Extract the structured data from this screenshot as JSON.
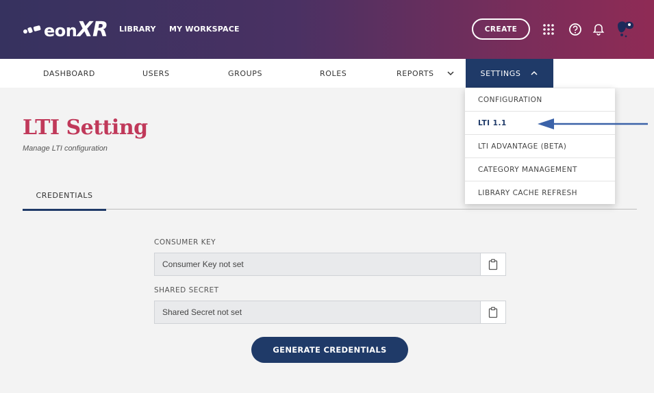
{
  "header": {
    "logo_text": "eon",
    "logo_xr": "XR",
    "links": [
      "LIBRARY",
      "MY WORKSPACE"
    ],
    "create_label": "CREATE"
  },
  "nav": {
    "items": [
      "DASHBOARD",
      "USERS",
      "GROUPS",
      "ROLES",
      "REPORTS"
    ],
    "active": "SETTINGS"
  },
  "settings_menu": {
    "items": [
      "CONFIGURATION",
      "LTI 1.1",
      "LTI ADVANTAGE (BETA)",
      "CATEGORY MANAGEMENT",
      "LIBRARY CACHE REFRESH"
    ],
    "active": "LTI 1.1"
  },
  "page": {
    "title": "LTI Setting",
    "subtitle": "Manage LTI configuration"
  },
  "tabs": [
    "CREDENTIALS"
  ],
  "form": {
    "consumer_key_label": "CONSUMER KEY",
    "consumer_key_value": "Consumer Key not set",
    "shared_secret_label": "SHARED SECRET",
    "shared_secret_value": "Shared Secret not set",
    "generate_label": "GENERATE CREDENTIALS"
  },
  "colors": {
    "primary": "#1f3a68",
    "title": "#c0395a",
    "arrow": "#3b62a8"
  }
}
